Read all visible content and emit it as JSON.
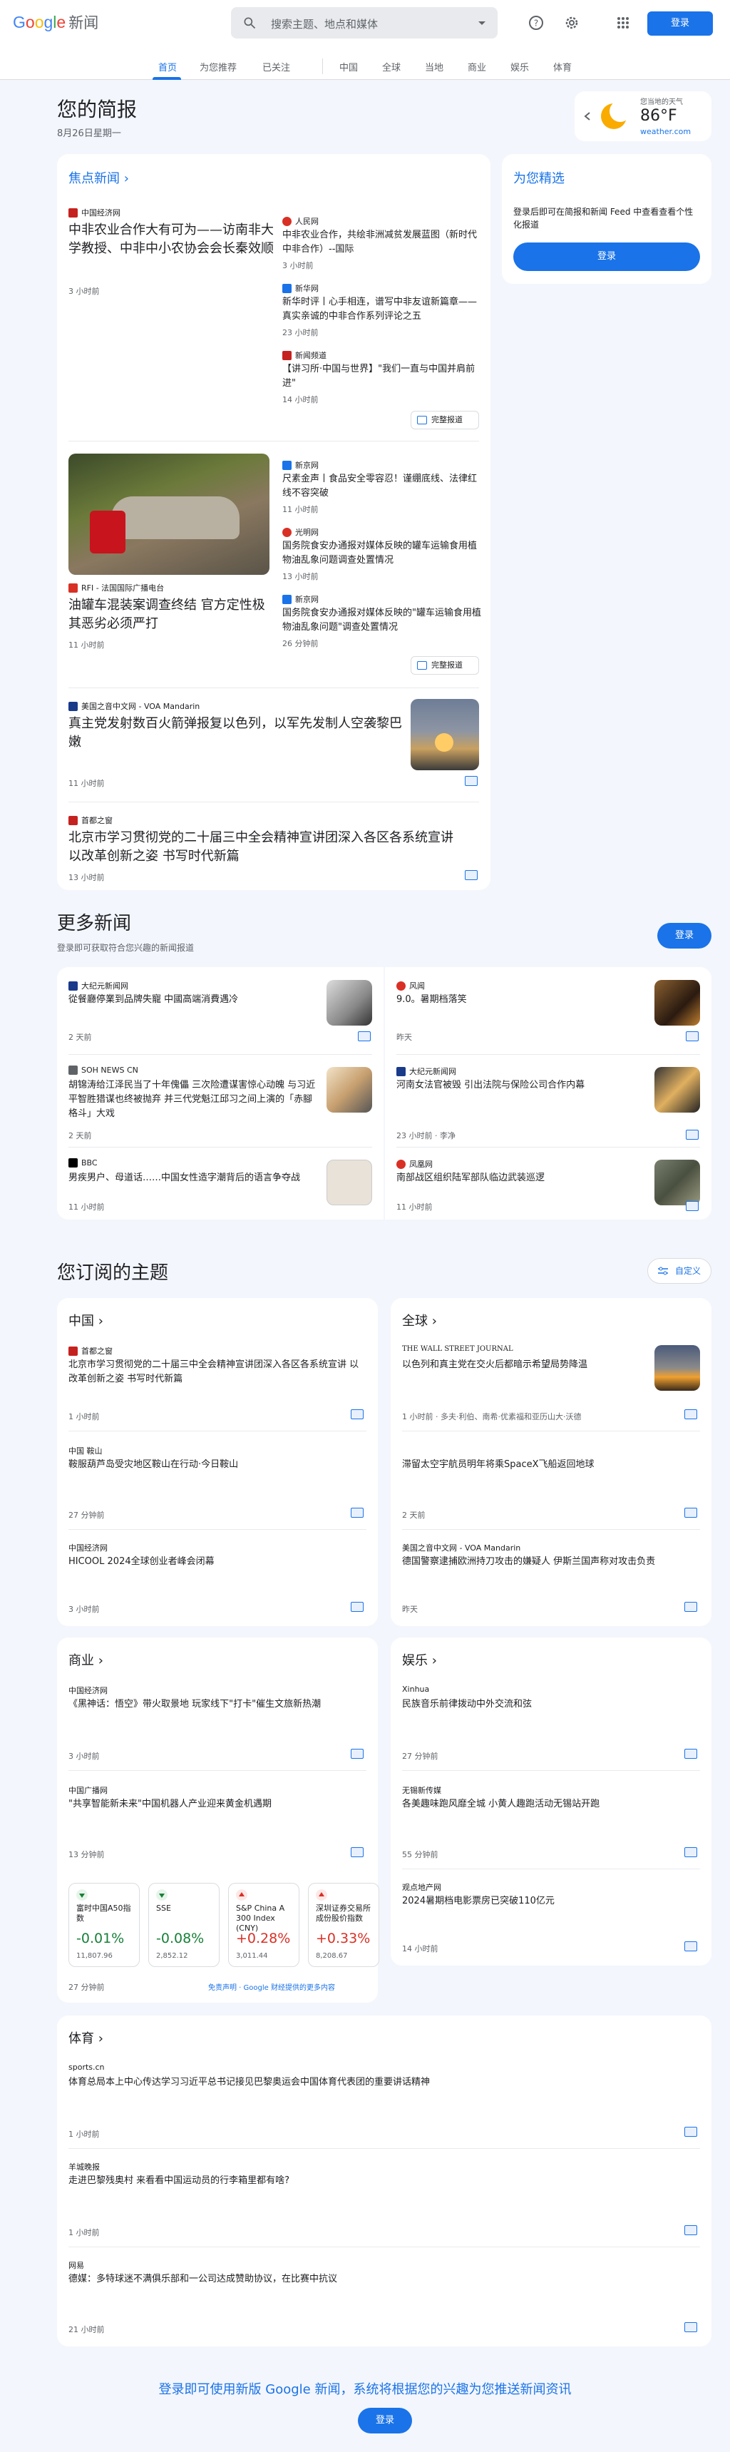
{
  "header": {
    "logo_google": "Google",
    "logo_news": "新闻",
    "search_placeholder": "搜索主题、地点和媒体",
    "signin": "登录"
  },
  "nav": {
    "items": [
      "首页",
      "为您推荐",
      "已关注",
      "中国",
      "全球",
      "当地",
      "商业",
      "娱乐",
      "体育"
    ]
  },
  "briefing": {
    "title": "您的简报",
    "date": "8月26日星期一"
  },
  "weather": {
    "label": "您当地的天气",
    "temp": "86°F",
    "source": "weather.com"
  },
  "top": {
    "title": "焦点新闻",
    "cluster1": {
      "main_source": "中国经济网",
      "main_title": "中非农业合作大有可为——访南非大学教授、中非中小农协会会长秦效顺",
      "main_time": "3 小时前",
      "side": [
        {
          "source": "人民网",
          "title": "中非农业合作，共绘非洲减贫发展蓝图（新时代中非合作）--国际",
          "time": "3 小时前"
        },
        {
          "source": "新华网",
          "title": "新华时评丨心手相连，谱写中非友谊新篇章——真实亲诚的中非合作系列评论之五",
          "time": "23 小时前"
        },
        {
          "source": "新闻频道",
          "title": "【讲习所·中国与世界】\"我们一直与中国并肩前进\"",
          "time": "14 小时前"
        }
      ],
      "full": "完整报道"
    },
    "cluster2": {
      "main_source": "RFI - 法国国际广播电台",
      "main_title": "油罐车混装案调查终结 官方定性极其恶劣必须严打",
      "main_time": "11 小时前",
      "side": [
        {
          "source": "新京网",
          "title": "尺素金声丨食品安全零容忍！谨绷底线、法律红线不容突破",
          "time": "11 小时前"
        },
        {
          "source": "光明网",
          "title": "国务院食安办通报对媒体反映的罐车运输食用植物油乱象问题调查处置情况",
          "time": "13 小时前"
        },
        {
          "source": "新京网",
          "title": "国务院食安办通报对媒体反映的\"罐车运输食用植物油乱象问题\"调查处置情况",
          "time": "26 分钟前"
        }
      ],
      "full": "完整报道"
    },
    "story3": {
      "source": "美国之音中文网 - VOA Mandarin",
      "title": "真主党发射数百火箭弹报复以色列，以军先发制人空袭黎巴嫩",
      "time": "11 小时前"
    },
    "story4": {
      "source": "首都之窗",
      "title": "北京市学习贯彻党的二十届三中全会精神宣讲团深入各区各系统宣讲 以改革创新之姿 书写时代新篇",
      "time": "13 小时前"
    }
  },
  "foryou": {
    "title": "为您精选",
    "desc": "登录后即可在简报和新闻 Feed 中查看查看个性化报道",
    "signin": "登录"
  },
  "more": {
    "title": "更多新闻",
    "desc": "登录即可获取符合您兴趣的新闻报道",
    "signin": "登录",
    "items": [
      {
        "source": "大纪元新闻网",
        "title": "從餐廳停業到品牌失寵 中國高端消費遇冷",
        "time": "2 天前"
      },
      {
        "source": "风闻",
        "title": "9.0。暑期档落笑",
        "time": "昨天"
      },
      {
        "source": "SOH NEWS CN",
        "title": "胡锦涛给江泽民当了十年傀儡 三次险遭谋害惊心动魄 与习近平智胜猎谋也终被抛弃 并三代党魁江邱习之间上演的「赤腳格斗」大戏",
        "time": "2 天前"
      },
      {
        "source": "大纪元新闻网",
        "title": "河南女法官被毁 引出法院与保险公司合作内幕",
        "time": "23 小时前 · 李净"
      },
      {
        "source": "BBC",
        "title": "男疾男户、母道话……中国女性造字潮背后的语言争夺战",
        "time": "11 小时前"
      },
      {
        "source": "凤凰网",
        "title": "南部战区组织陆军部队临边武装巡逻",
        "time": "11 小时前"
      }
    ]
  },
  "topics": {
    "title": "您订阅的主题",
    "customize": "自定义",
    "china": {
      "title": "中国",
      "items": [
        {
          "source": "首都之窗",
          "title": "北京市学习贯彻党的二十届三中全会精神宣讲团深入各区各系统宣讲 以改革创新之姿 书写时代新篇",
          "time": "1 小时前"
        },
        {
          "source": "中国 鞍山",
          "title": "鞍服葫芦岛受灾地区鞍山在行动·今日鞍山",
          "time": "27 分钟前"
        },
        {
          "source": "中国经济网",
          "title": "HICOOL 2024全球创业者峰会闭幕",
          "time": "3 小时前"
        }
      ]
    },
    "world": {
      "title": "全球",
      "items": [
        {
          "source": "THE WALL STREET JOURNAL",
          "title": "以色列和真主党在交火后都暗示希望局势降温",
          "time": "1 小时前 · 多夫·利伯、南希·优素福和亚历山大·沃德"
        },
        {
          "source": "",
          "title": "滞留太空宇航员明年将乘SpaceX飞船返回地球",
          "time": "2 天前"
        },
        {
          "source": "美国之音中文网 - VOA Mandarin",
          "title": "德国警察逮捕欧洲持刀攻击的嫌疑人 伊斯兰国声称对攻击负责",
          "time": "昨天"
        }
      ]
    },
    "business": {
      "title": "商业",
      "items": [
        {
          "source": "中国经济网",
          "title": "《黑神话：悟空》带火取景地 玩家线下\"打卡\"催生文旅新热潮",
          "time": "3 小时前"
        },
        {
          "source": "中国广播网",
          "title": "\"共享智能新未来\"中国机器人产业迎来黄金机遇期",
          "time": "13 分钟前"
        }
      ],
      "stocks": [
        {
          "name": "富时中国A50指数",
          "value": "-0.01%",
          "price": "11,807.96",
          "dir": "down"
        },
        {
          "name": "SSE",
          "value": "-0.08%",
          "price": "2,852.12",
          "dir": "down"
        },
        {
          "name": "S&P China A 300 Index (CNY)",
          "value": "+0.28%",
          "price": "3,011.44",
          "dir": "up"
        },
        {
          "name": "深圳证券交易所成份股价指数",
          "value": "+0.33%",
          "price": "8,208.67",
          "dir": "up"
        }
      ],
      "stocks_time": "27 分钟前",
      "disclaimer": "免责声明 · Google 财经提供的更多内容"
    },
    "ent": {
      "title": "娱乐",
      "items": [
        {
          "source": "Xinhua",
          "title": "民族音乐前律拨动中外交流和弦",
          "time": "27 分钟前"
        },
        {
          "source": "无锡新传媒",
          "title": "各美趣味跑风靡全城 小黄人趣跑活动无锡站开跑",
          "time": "55 分钟前"
        },
        {
          "source": "观点地产网",
          "title": "2024暑期档电影票房已突破110亿元",
          "time": "14 小时前"
        }
      ]
    },
    "sports": {
      "title": "体育",
      "items": [
        {
          "source": "sports.cn",
          "title": "体育总局本上中心传达学习习近平总书记接见巴黎奥运会中国体育代表团的重要讲话精神",
          "time": "1 小时前"
        },
        {
          "source": "羊城晚报",
          "title": "走进巴黎残奥村 来看看中国运动员的行李箱里都有啥?",
          "time": "1 小时前"
        },
        {
          "source": "网易",
          "title": "德媒：多特球迷不满俱乐部和一公司达成赞助协议，在比赛中抗议",
          "time": "21 小时前"
        }
      ]
    }
  },
  "footer": {
    "text": "登录即可使用新版 Google 新闻，系统将根据您的兴趣为您推送新闻资讯",
    "signin": "登录"
  },
  "colors": {
    "accent": "#1a73e8",
    "up": "#d93025",
    "down": "#188038"
  }
}
